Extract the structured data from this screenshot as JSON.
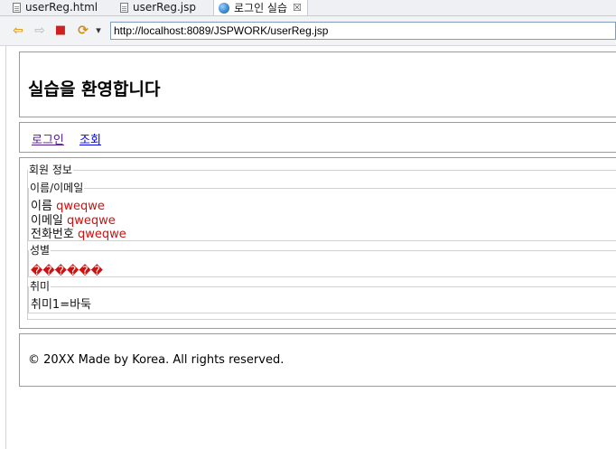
{
  "tabs": [
    {
      "label": "userReg.html",
      "icon": "document-icon"
    },
    {
      "label": "userReg.jsp",
      "icon": "document-icon"
    },
    {
      "label": "로그인 실습",
      "icon": "globe-icon",
      "close": "☒",
      "active": true
    }
  ],
  "toolbar": {
    "back_icon": "⇦",
    "forward_icon": "⇨",
    "stop_icon": "■",
    "refresh_icon": "⟳",
    "menu_icon": "▾",
    "url": "http://localhost:8089/JSPWORK/userReg.jsp"
  },
  "colors": {
    "value_red": "#cc1111",
    "link_visited": "#551a8b",
    "link": "#0000ee",
    "back_arrow": "#e0a020",
    "stop": "#cc2222"
  },
  "page": {
    "header_title": "실습을 환영합니다",
    "nav": {
      "login": "로그인",
      "search": "조회"
    },
    "member_info": {
      "legend": "회원 정보",
      "name_email": {
        "legend": "이름/이메일",
        "name_label": "이름",
        "name_value": "qweqwe",
        "email_label": "이메일",
        "email_value": "qweqwe",
        "phone_label": "전화번호",
        "phone_value": "qweqwe"
      },
      "gender": {
        "legend": "성별",
        "value": "������"
      },
      "hobby": {
        "legend": "취미",
        "line": "취미1=바둑"
      }
    },
    "footer": "© 20XX Made by Korea. All rights reserved."
  }
}
